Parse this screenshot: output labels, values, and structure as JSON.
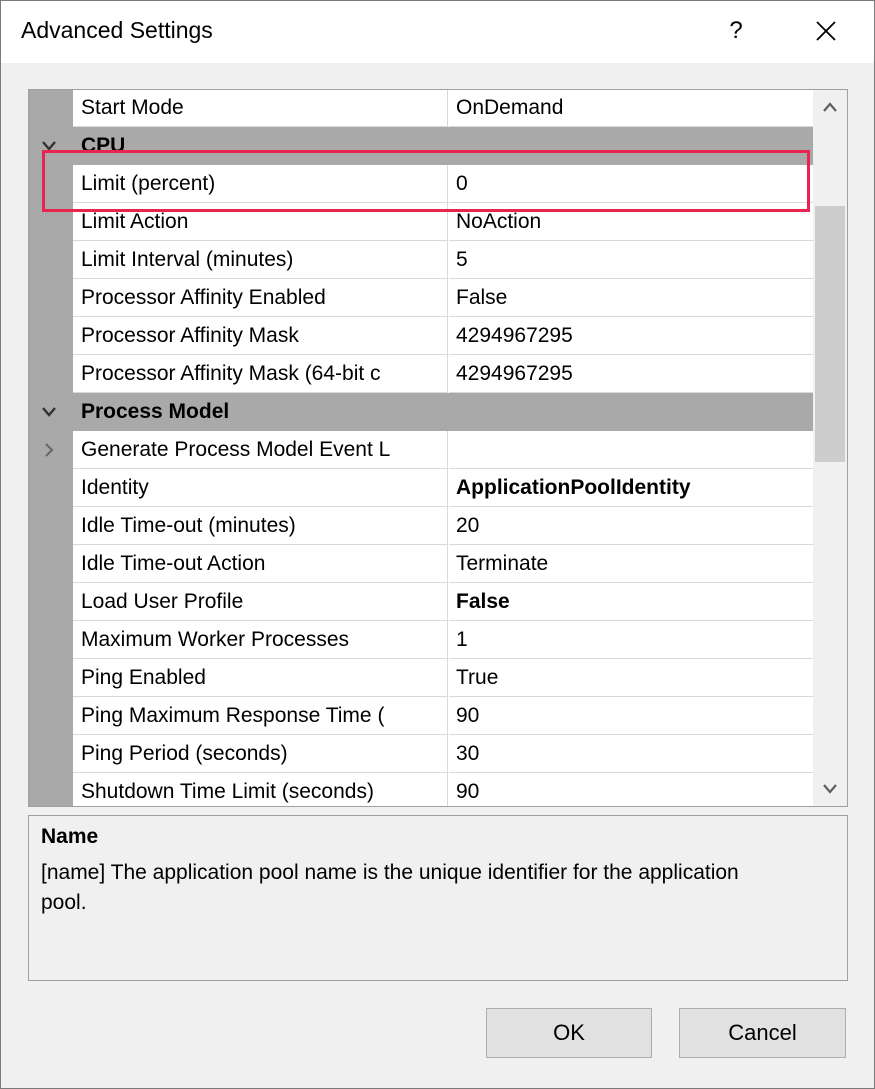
{
  "window": {
    "title": "Advanced Settings",
    "help_glyph": "?"
  },
  "property_grid": {
    "rows": [
      {
        "type": "property",
        "name": "Start Mode",
        "value": "OnDemand",
        "bold": false
      },
      {
        "type": "category",
        "label": "CPU",
        "expanded": true
      },
      {
        "type": "property",
        "name": "Limit (percent)",
        "value": "0",
        "bold": false
      },
      {
        "type": "property",
        "name": "Limit Action",
        "value": "NoAction",
        "bold": false
      },
      {
        "type": "property",
        "name": "Limit Interval (minutes)",
        "value": "5",
        "bold": false
      },
      {
        "type": "property",
        "name": "Processor Affinity Enabled",
        "value": "False",
        "bold": false
      },
      {
        "type": "property",
        "name": "Processor Affinity Mask",
        "value": "4294967295",
        "bold": false
      },
      {
        "type": "property",
        "name": "Processor Affinity Mask (64-bit c",
        "value": "4294967295",
        "bold": false
      },
      {
        "type": "category",
        "label": "Process Model",
        "expanded": true
      },
      {
        "type": "property",
        "name": "Generate Process Model Event L",
        "value": "",
        "bold": false,
        "expandable": true
      },
      {
        "type": "property",
        "name": "Identity",
        "value": "ApplicationPoolIdentity",
        "bold": true
      },
      {
        "type": "property",
        "name": "Idle Time-out (minutes)",
        "value": "20",
        "bold": false
      },
      {
        "type": "property",
        "name": "Idle Time-out Action",
        "value": "Terminate",
        "bold": false
      },
      {
        "type": "property",
        "name": "Load User Profile",
        "value": "False",
        "bold": true
      },
      {
        "type": "property",
        "name": "Maximum Worker Processes",
        "value": "1",
        "bold": false
      },
      {
        "type": "property",
        "name": "Ping Enabled",
        "value": "True",
        "bold": false
      },
      {
        "type": "property",
        "name": "Ping Maximum Response Time (",
        "value": "90",
        "bold": false
      },
      {
        "type": "property",
        "name": "Ping Period (seconds)",
        "value": "30",
        "bold": false
      },
      {
        "type": "property",
        "name": "Shutdown Time Limit (seconds)",
        "value": "90",
        "bold": false
      }
    ],
    "highlighted_property": "Limit (percent)"
  },
  "description": {
    "title": "Name",
    "text": "[name] The application pool name is the unique identifier for the application pool."
  },
  "buttons": {
    "ok_label": "OK",
    "cancel_label": "Cancel"
  },
  "colors": {
    "highlight": "#e8244f",
    "category_band": "#a9a9a9"
  }
}
